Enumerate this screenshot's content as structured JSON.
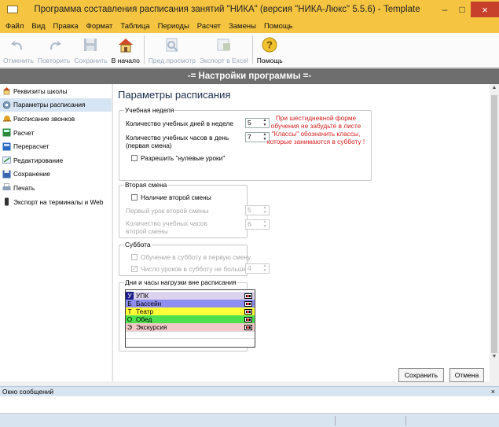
{
  "window": {
    "title": "Программа составления расписания занятий \"НИКА\" (версия \"НИКА-Люкс\" 5.5.6) - Template",
    "min": "–",
    "max": "□",
    "close": "×"
  },
  "menu": [
    "Файл",
    "Вид",
    "Правка",
    "Формат",
    "Таблица",
    "Периоды",
    "Расчет",
    "Замены",
    "Помощь"
  ],
  "toolbar": [
    {
      "label": "Отменить",
      "icon": "undo-icon",
      "enabled": false
    },
    {
      "label": "Повторить",
      "icon": "redo-icon",
      "enabled": false
    },
    {
      "label": "Сохранить",
      "icon": "save-icon",
      "enabled": false
    },
    {
      "label": "В начало",
      "icon": "home-icon",
      "enabled": true
    },
    {
      "label": "Пред.просмотр",
      "icon": "preview-icon",
      "enabled": false
    },
    {
      "label": "Экспорт в Excel",
      "icon": "excel-icon",
      "enabled": false
    },
    {
      "label": "Помощь",
      "icon": "help-icon",
      "enabled": true
    }
  ],
  "banner": "-= Настройки программы =-",
  "sidebar": [
    {
      "label": "Реквизиты школы",
      "icon": "school-icon",
      "selected": false
    },
    {
      "label": "Параметры расписания",
      "icon": "settings-icon",
      "selected": true
    },
    {
      "label": "Расписание звонков",
      "icon": "bell-icon",
      "selected": false
    },
    {
      "label": "Расчет",
      "icon": "calculate-icon",
      "selected": false
    },
    {
      "label": "Перерасчет",
      "icon": "recalculate-icon",
      "selected": false
    },
    {
      "label": "Редактирование",
      "icon": "edit-icon",
      "selected": false
    },
    {
      "label": "Сохранение",
      "icon": "save-icon",
      "selected": false
    },
    {
      "label": "Печать",
      "icon": "print-icon",
      "selected": false
    },
    {
      "label": "Экспорт на терминалы и Web",
      "icon": "terminal-icon",
      "selected": false
    }
  ],
  "main": {
    "title": "Параметры расписания",
    "week": {
      "legend": "Учебная неделя",
      "days_label": "Количество учебных дней в неделе",
      "days_value": "5",
      "hours_label": "Количество учебных часов в день",
      "hours_sub": "(первая смена)",
      "hours_value": "7",
      "zero_lessons": "Разрешить \"нулевые уроки\"",
      "warning": "При шестидневной форме обучения не забудьте в листе \"Классы\" обозначить классы, которые занимаются в субботу !"
    },
    "shift": {
      "legend": "Вторая смена",
      "has_second": "Наличие второй смены",
      "first_lesson_label": "Первый урок второй смены",
      "first_lesson_value": "5",
      "hours_label": "Количество учебных часов",
      "hours_sub": "второй смены",
      "hours_value": "6"
    },
    "saturday": {
      "legend": "Суббота",
      "first_shift": "Обучение в субботу в первую смену",
      "max_lessons": "Число уроков в субботу не больше",
      "max_value": "4"
    },
    "load": {
      "legend": "Дни и часы нагрузки вне расписания",
      "items": [
        {
          "letter": "У",
          "name": "УПК",
          "color": "#dcd3ee",
          "letter_bg": "#1c1c8a",
          "letter_color": "#ffffff"
        },
        {
          "letter": "Б",
          "name": "Бассейн",
          "color": "#8e8ef0",
          "letter_bg": "#8e8ef0",
          "letter_color": "#000000"
        },
        {
          "letter": "Т",
          "name": "Театр",
          "color": "#ffff3a",
          "letter_bg": "#ffff3a",
          "letter_color": "#000000"
        },
        {
          "letter": "О",
          "name": "Обед",
          "color": "#4ee04e",
          "letter_bg": "#4ee04e",
          "letter_color": "#000000"
        },
        {
          "letter": "Э",
          "name": "Экскурсия",
          "color": "#f2c8c8",
          "letter_bg": "#f2c8c8",
          "letter_color": "#000000"
        }
      ]
    },
    "save_button": "Сохранить",
    "cancel_button": "Отмена"
  },
  "messages": {
    "title": "Окно сообщений",
    "close": "×"
  }
}
